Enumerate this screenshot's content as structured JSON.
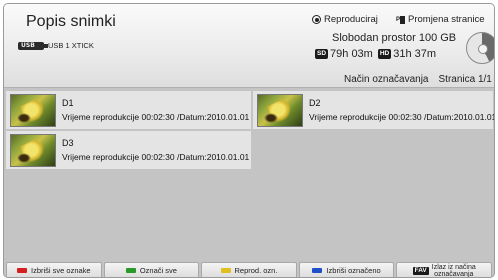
{
  "header": {
    "title": "Popis snimki",
    "device_label": "USB 1 XTICK",
    "option_play": "Reproduciraj",
    "option_page": "Promjena stranice",
    "free_space": "Slobodan prostor 100 GB",
    "sd_badge": "SD",
    "sd_time": "79h 03m",
    "hd_badge": "HD",
    "hd_time": "31h 37m",
    "mode": "Način označavanja",
    "page": "Stranica 1/1"
  },
  "recordings": [
    {
      "name": "D1",
      "meta": "Vrijeme reprodukcije 00:02:30 /Datum:2010.01.01"
    },
    {
      "name": "D2",
      "meta": "Vrijeme reprodukcije 00:02:30 /Datum:2010.01.01"
    },
    {
      "name": "D3",
      "meta": "Vrijeme reprodukcije 00:02:30 /Datum:2010.01.01"
    }
  ],
  "footer": {
    "buttons": [
      {
        "label": "Izbriši sve oznake",
        "key_color": "#d62020"
      },
      {
        "label": "Označi sve",
        "key_color": "#2a9a2a"
      },
      {
        "label": "Reprod. ozn.",
        "key_color": "#e0c020"
      },
      {
        "label": "Izbriši označeno",
        "key_color": "#2050c8"
      }
    ],
    "exit_key": "FAV",
    "exit_label_1": "Izlaz iz načina",
    "exit_label_2": "označavanja"
  },
  "colors": {
    "background": "#c4c4c4",
    "header": "#ececec",
    "item": "#e4e4e4"
  },
  "disk_usage_percent": 42
}
